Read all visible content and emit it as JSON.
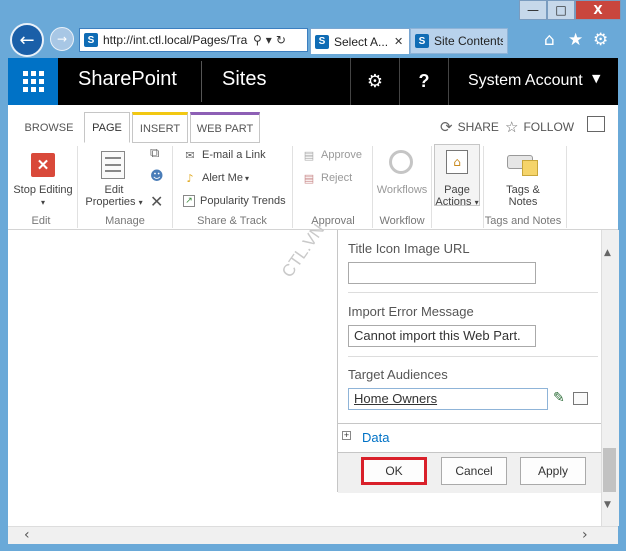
{
  "window": {
    "minimize": "—",
    "maximize": "□",
    "close": "X"
  },
  "browser": {
    "url": "http://int.ctl.local/Pages/Tra",
    "search_icon": "⚲",
    "dropdown_icon": "▾",
    "refresh_icon": "↻",
    "tabs": [
      {
        "label": "Select A...",
        "close": "✕"
      },
      {
        "label": "Site Contents"
      }
    ],
    "toolbar_icons": [
      "home-icon",
      "star-icon",
      "gear-icon"
    ]
  },
  "suite_bar": {
    "brand": "SharePoint",
    "sites": "Sites",
    "help": "?",
    "account": "System Account"
  },
  "ribbon": {
    "tabs": [
      "BROWSE",
      "PAGE",
      "INSERT",
      "WEB PART"
    ],
    "share": "SHARE",
    "follow": "FOLLOW",
    "groups": {
      "edit": {
        "label": "Edit",
        "stop_editing": "Stop Editing"
      },
      "manage": {
        "label": "Manage",
        "edit_properties_1": "Edit",
        "edit_properties_2": "Properties"
      },
      "share_track": {
        "label": "Share & Track",
        "email_link": "E-mail a Link",
        "alert_me": "Alert Me",
        "popularity": "Popularity Trends"
      },
      "approval": {
        "label": "Approval",
        "approve": "Approve",
        "reject": "Reject"
      },
      "workflow": {
        "label": "Workflow",
        "workflows": "Workflows"
      },
      "page_actions": {
        "line1": "Page",
        "line2": "Actions"
      },
      "tags_notes": {
        "label": "Tags and Notes",
        "line1": "Tags &",
        "line2": "Notes"
      }
    }
  },
  "tool_pane": {
    "title_icon_label": "Title Icon Image URL",
    "title_icon_value": "",
    "import_error_label": "Import Error Message",
    "import_error_value": "Cannot import this Web Part.",
    "target_audiences_label": "Target Audiences",
    "target_audiences_value": "Home Owners",
    "data_section": "Data",
    "data_toggle": "+",
    "ok": "OK",
    "cancel": "Cancel",
    "apply": "Apply"
  },
  "watermark": "CTL.VN",
  "colors": {
    "highlight": "#d9202a",
    "suite_blue": "#0072c6",
    "link": "#0072c6"
  }
}
